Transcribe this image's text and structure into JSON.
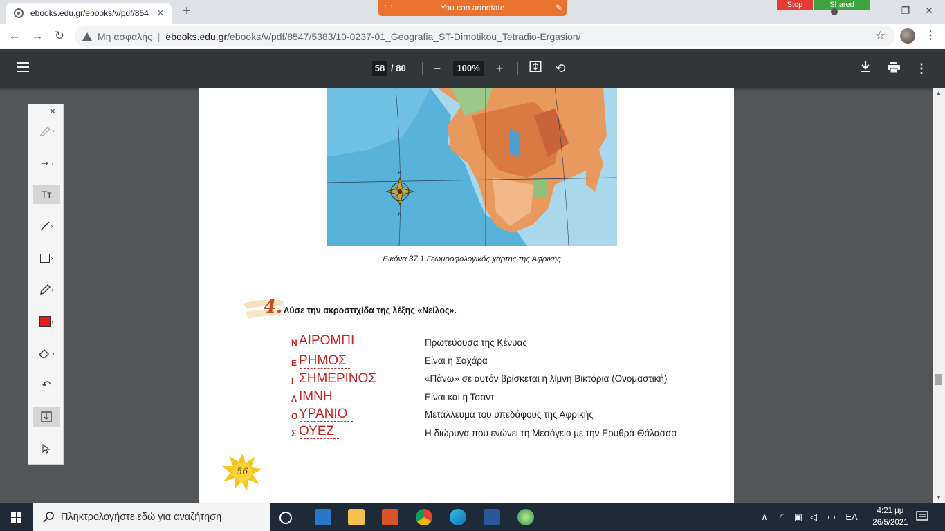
{
  "browser": {
    "tab_title": "ebooks.edu.gr/ebooks/v/pdf/854",
    "tab_close": "✕",
    "new_tab": "+",
    "annotate_banner": "You can annotate",
    "stop_label": "Stop",
    "shared_label": "Shared",
    "security_label": "Μη ασφαλής",
    "url_domain": "ebooks.edu.gr",
    "url_path": "/ebooks/v/pdf/8547/5383/10-0237-01_Geografia_ST-Dimotikou_Tetradio-Ergasion/"
  },
  "pdf_toolbar": {
    "page_current": "58",
    "page_total": "/ 80",
    "zoom": "100%"
  },
  "document": {
    "map_caption": "Εικόνα 37.1 Γεωμορφολογικός χάρτης της Αφρικής",
    "compass_north": "Β",
    "compass_south": "Ν",
    "question_number": "4.",
    "question_text": "Λύσε την ακροστιχίδα της λέξης «Νείλος».",
    "page_number": "56",
    "acrostic": [
      {
        "initial": "Ν",
        "answer": "ΑΙΡΟΜΠΙ",
        "clue": "Πρωτεύουσα της Κένυας"
      },
      {
        "initial": "Ε",
        "answer": "ΡΗΜΟΣ",
        "clue": "Είναι η Σαχάρα"
      },
      {
        "initial": "Ι",
        "answer": "ΣΗΜΕΡΙΝΟΣ",
        "clue": "«Πάνω» σε αυτόν βρίσκεται η λίμνη Βικτόρια (Ονομαστική)"
      },
      {
        "initial": "Λ",
        "answer": "ΙΜΝΗ",
        "clue": "Είναι και η Τσαντ"
      },
      {
        "initial": "Ο",
        "answer": "ΥΡΑΝΙΟ",
        "clue": "Μετάλλευμα του υπεδάφους της Αφρικής"
      },
      {
        "initial": "Σ",
        "answer": "ΟΥΕΖ",
        "clue": "Η διώρυγα που ενώνει τη Μεσόγειο με την Ερυθρά Θάλασσα"
      }
    ]
  },
  "palette": {
    "close": "✕",
    "tools": [
      "highlighter-icon",
      "arrow-icon",
      "text-icon",
      "line-icon",
      "rectangle-icon",
      "pen-icon",
      "color-red-icon",
      "eraser-icon",
      "undo-icon",
      "save-icon",
      "pointer-icon"
    ]
  },
  "taskbar": {
    "search_placeholder": "Πληκτρολογήστε εδώ για αναζήτηση",
    "language": "ΕΛ",
    "time": "4:21 μμ",
    "date": "26/5/2021"
  },
  "colors": {
    "annotation_red": "#c82222",
    "banner_orange": "#e8722e",
    "pdf_toolbar": "#323639"
  }
}
